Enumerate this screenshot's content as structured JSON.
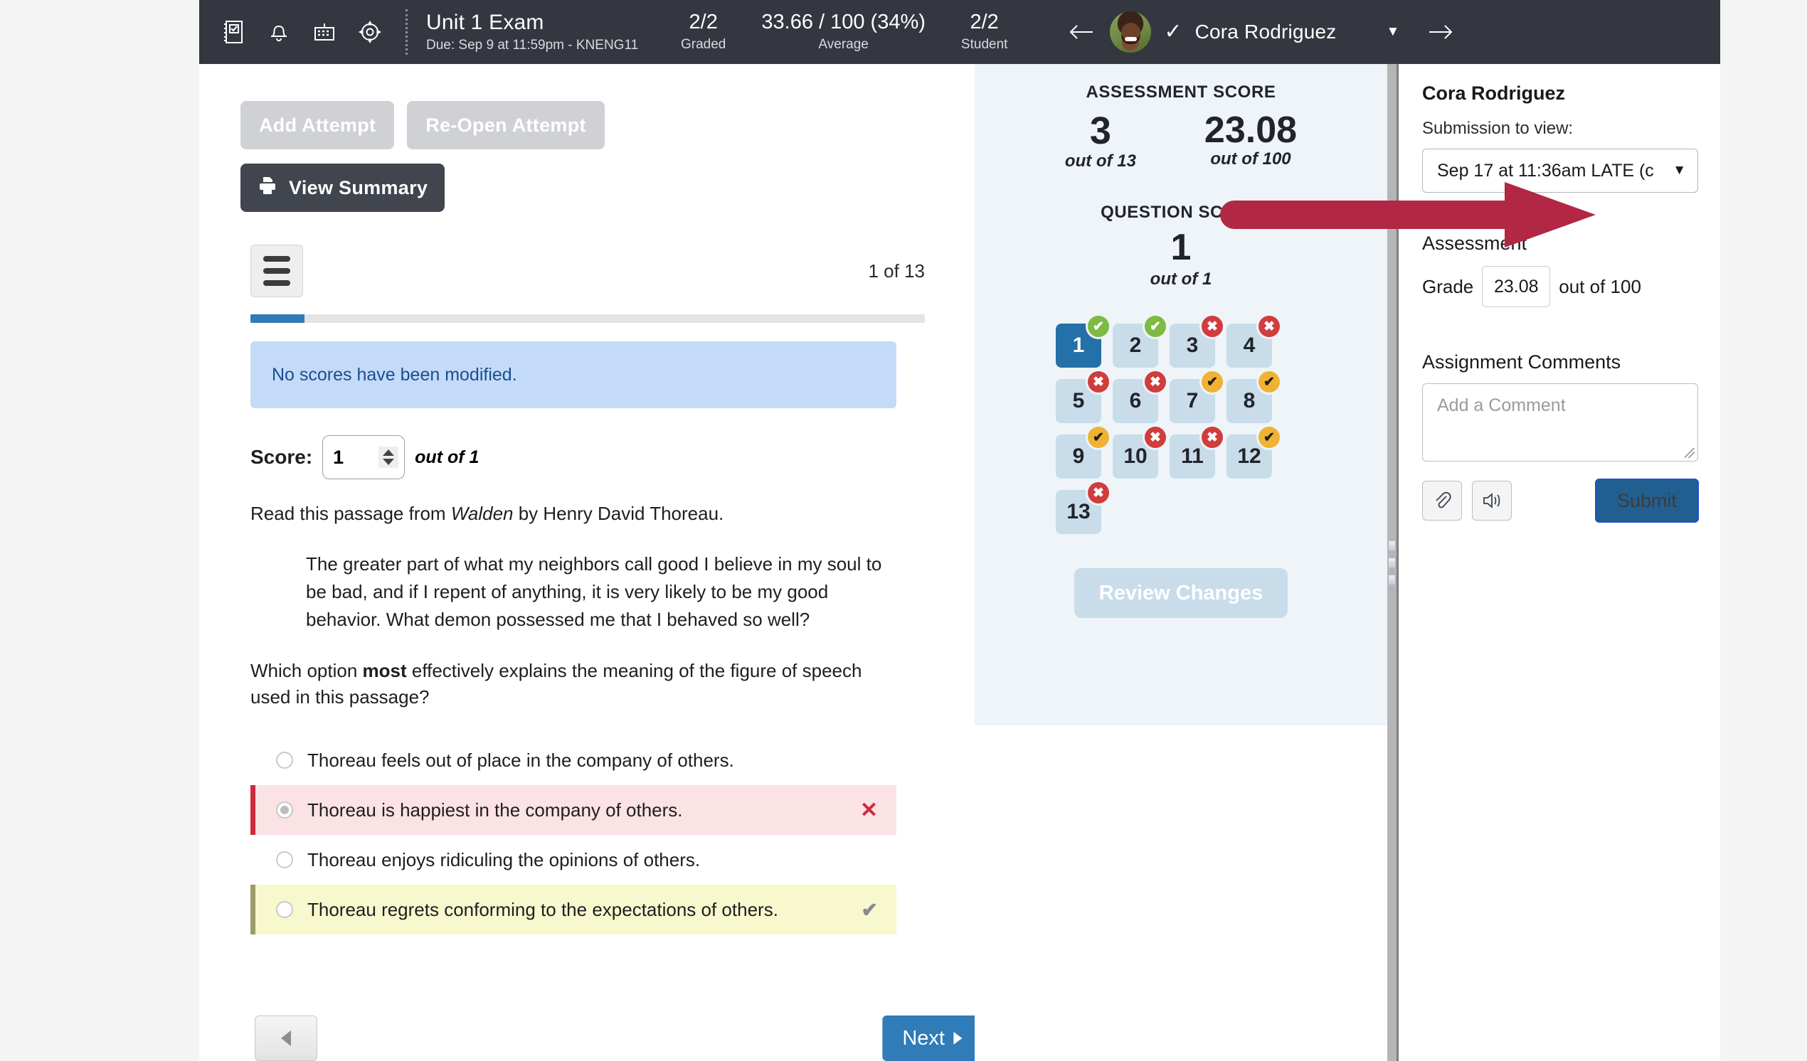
{
  "topbar": {
    "icons": [
      "gradebook-icon",
      "bell-icon",
      "calendar-icon",
      "gear-icon"
    ],
    "title": "Unit 1 Exam",
    "subtitle": "Due: Sep 9 at 11:59pm - KNENG11",
    "stats": [
      {
        "value": "2/2",
        "label": "Graded"
      },
      {
        "value": "33.66 / 100 (34%)",
        "label": "Average"
      },
      {
        "value": "2/2",
        "label": "Student"
      }
    ],
    "student_name": "Cora Rodriguez",
    "prev_student_icon": "arrow-left-icon",
    "next_student_icon": "arrow-right-icon",
    "student_check_icon": "check-icon",
    "student_dropdown_icon": "chevron-down-icon"
  },
  "left": {
    "add_attempt_label": "Add Attempt",
    "reopen_attempt_label": "Re-Open Attempt",
    "view_summary_label": "View Summary",
    "question_counter": "1 of 13",
    "progress_percent": 8,
    "alert_text": "No scores have been modified.",
    "score_label": "Score:",
    "score_value": "1",
    "score_out_of": "out of 1",
    "intro_text_before": "Read this passage from ",
    "intro_text_italic": "Walden",
    "intro_text_after": " by Henry David Thoreau.",
    "passage": "The greater part of what my neighbors call good I believe in my soul to be bad, and if I repent of anything, it is very likely to be my good behavior. What demon possessed me that I behaved so well?",
    "prompt_before": "Which option ",
    "prompt_bold": "most",
    "prompt_after": " effectively explains the meaning of the figure of speech used in this passage?",
    "options": [
      {
        "text": "Thoreau feels out of place in the company of others.",
        "state": "none",
        "mark": "",
        "selected": false
      },
      {
        "text": "Thoreau is happiest in the company of others.",
        "state": "wrong",
        "mark": "✕",
        "selected": true
      },
      {
        "text": "Thoreau enjoys ridiculing the opinions of others.",
        "state": "none",
        "mark": "",
        "selected": false
      },
      {
        "text": "Thoreau regrets conforming to the expectations of others.",
        "state": "correct",
        "mark": "✔",
        "selected": false
      }
    ],
    "prev_label": "",
    "next_label": "Next"
  },
  "center": {
    "assessment_score_title": "ASSESSMENT SCORE",
    "assessment_points": "3",
    "assessment_points_out": "out of 13",
    "assessment_percent": "23.08",
    "assessment_percent_out": "out of 100",
    "question_score_title": "QUESTION SCORE",
    "question_points": "1",
    "question_points_out": "out of 1",
    "review_changes_label": "Review Changes",
    "questions": [
      {
        "n": "1",
        "status": "correct",
        "active": true
      },
      {
        "n": "2",
        "status": "correct",
        "active": false
      },
      {
        "n": "3",
        "status": "incorrect",
        "active": false
      },
      {
        "n": "4",
        "status": "incorrect",
        "active": false
      },
      {
        "n": "5",
        "status": "incorrect",
        "active": false
      },
      {
        "n": "6",
        "status": "incorrect",
        "active": false
      },
      {
        "n": "7",
        "status": "partial",
        "active": false
      },
      {
        "n": "8",
        "status": "partial",
        "active": false
      },
      {
        "n": "9",
        "status": "partial",
        "active": false
      },
      {
        "n": "10",
        "status": "incorrect",
        "active": false
      },
      {
        "n": "11",
        "status": "incorrect",
        "active": false
      },
      {
        "n": "12",
        "status": "partial",
        "active": false
      },
      {
        "n": "13",
        "status": "incorrect",
        "active": false
      }
    ]
  },
  "right": {
    "student_name": "Cora Rodriguez",
    "submission_label": "Submission to view:",
    "submission_value": "Sep 17 at 11:36am LATE (c",
    "assessment_heading": "Assessment",
    "grade_label": "Grade",
    "grade_value": "23.08",
    "grade_out_of": "out of 100",
    "comments_heading": "Assignment Comments",
    "comment_placeholder": "Add a Comment",
    "attach_icon": "paperclip-icon",
    "audio_icon": "speaker-icon",
    "submit_label": "Submit"
  },
  "annotation": {
    "type": "arrow",
    "color": "#b22744",
    "points_to": "submission-select"
  },
  "colors": {
    "topbar_bg": "#343740",
    "accent_blue": "#2470a8",
    "center_bg": "#eef4f8",
    "correct_green": "#7dbb42",
    "incorrect_red": "#d13c3c",
    "partial_amber": "#f0b232",
    "annotation_red": "#b22744"
  }
}
